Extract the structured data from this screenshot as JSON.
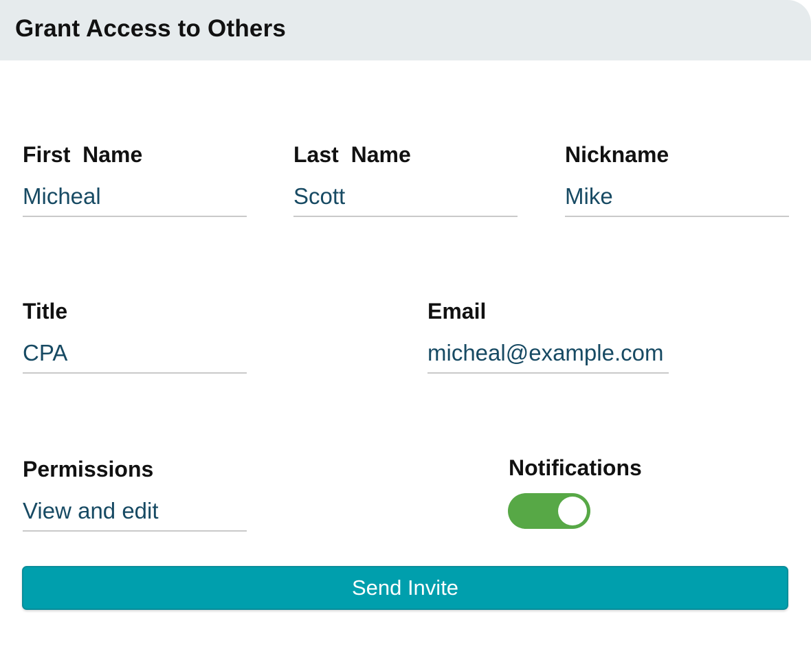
{
  "header": {
    "title": "Grant Access to Others"
  },
  "fields": {
    "first_name": {
      "label": "First  Name",
      "value": "Micheal"
    },
    "last_name": {
      "label": "Last  Name",
      "value": "Scott"
    },
    "nickname": {
      "label": "Nickname",
      "value": "Mike"
    },
    "title": {
      "label": "Title",
      "value": "CPA"
    },
    "email": {
      "label": "Email",
      "value": "micheal@example.com"
    },
    "permissions": {
      "label": "Permissions",
      "value": "View and edit"
    }
  },
  "notifications": {
    "label": "Notifications",
    "enabled": true,
    "on_color": "#57a846"
  },
  "actions": {
    "send_invite_label": "Send Invite",
    "button_color": "#009fad"
  },
  "colors": {
    "header_bg": "#e6ebed",
    "value_text": "#174a63"
  }
}
